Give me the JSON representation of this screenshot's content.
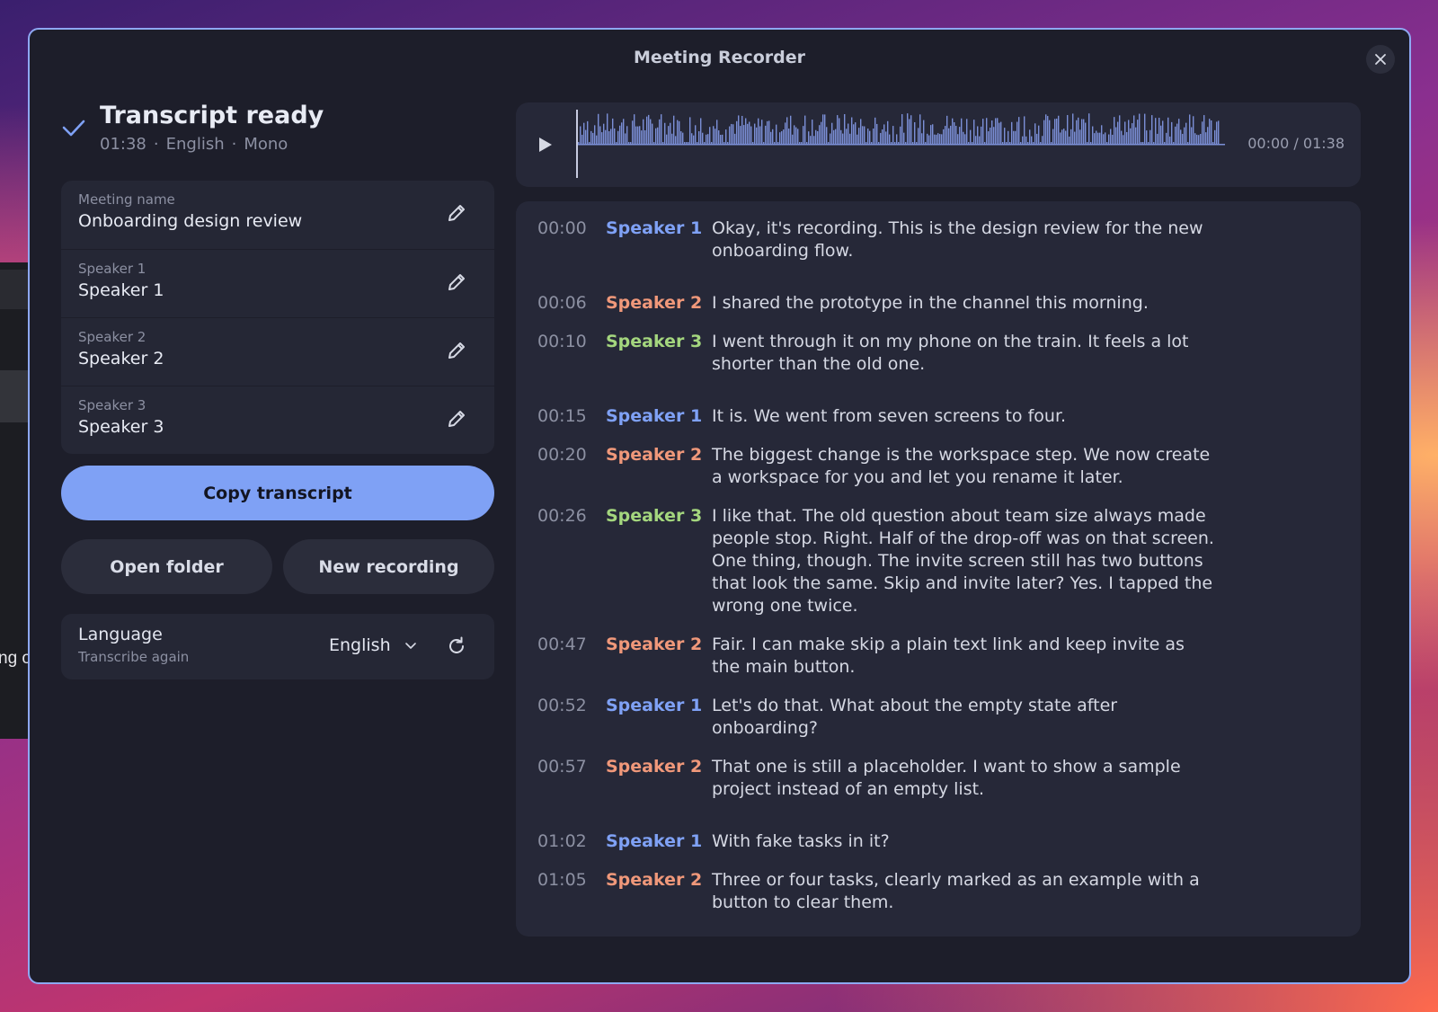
{
  "background_window": {
    "snippet": "ng o"
  },
  "dialog": {
    "title": "Meeting Recorder"
  },
  "status": {
    "title": "Transcript ready",
    "duration": "01:38",
    "language": "English",
    "channels": "Mono",
    "separator": "·"
  },
  "fields": [
    {
      "label": "Meeting name",
      "value": "Onboarding design review"
    },
    {
      "label": "Speaker 1",
      "value": "Speaker 1"
    },
    {
      "label": "Speaker 2",
      "value": "Speaker 2"
    },
    {
      "label": "Speaker 3",
      "value": "Speaker 3"
    }
  ],
  "actions": {
    "copy": "Copy transcript",
    "open_folder": "Open folder",
    "new_recording": "New recording"
  },
  "language_card": {
    "title": "Language",
    "subtitle": "Transcribe again",
    "selected": "English"
  },
  "player": {
    "time": "00:00 / 01:38",
    "progress": 0,
    "waveform_color": "#7b8fd6"
  },
  "colors": {
    "accent": "#7fa1f5",
    "speaker1": "#7fa1f5",
    "speaker2": "#f0987a",
    "speaker3": "#a4d67e",
    "border": "#8ea8f2"
  },
  "transcript": [
    {
      "time": "00:00",
      "speaker": "Speaker 1",
      "text": "Okay, it's recording. This is the design review for the new onboarding flow."
    },
    {
      "time": "00:06",
      "speaker": "Speaker 2",
      "text": "I shared the prototype in the channel this morning."
    },
    {
      "time": "00:10",
      "speaker": "Speaker 3",
      "text": "I went through it on my phone on the train. It feels a lot shorter than the old one."
    },
    {
      "time": "00:15",
      "speaker": "Speaker 1",
      "text": "It is. We went from seven screens to four."
    },
    {
      "time": "00:20",
      "speaker": "Speaker 2",
      "text": "The biggest change is the workspace step. We now create a workspace for you and let you rename it later."
    },
    {
      "time": "00:26",
      "speaker": "Speaker 3",
      "text": "I like that. The old question about team size always made people stop. Right. Half of the drop-off was on that screen. One thing, though. The invite screen still has two buttons that look the same. Skip and invite later? Yes. I tapped the wrong one twice."
    },
    {
      "time": "00:47",
      "speaker": "Speaker 2",
      "text": "Fair. I can make skip a plain text link and keep invite as the main button."
    },
    {
      "time": "00:52",
      "speaker": "Speaker 1",
      "text": "Let's do that. What about the empty state after onboarding?"
    },
    {
      "time": "00:57",
      "speaker": "Speaker 2",
      "text": "That one is still a placeholder. I want to show a sample project instead of an empty list."
    },
    {
      "time": "01:02",
      "speaker": "Speaker 1",
      "text": "With fake tasks in it?"
    },
    {
      "time": "01:05",
      "speaker": "Speaker 2",
      "text": "Three or four tasks, clearly marked as an example with a button to clear them."
    }
  ]
}
